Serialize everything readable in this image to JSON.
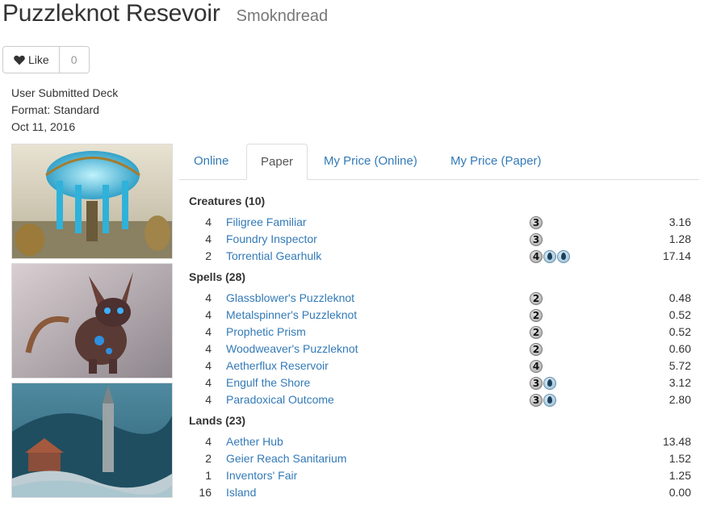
{
  "header": {
    "title": "Puzzleknot Resevoir",
    "author": "Smokndread"
  },
  "like": {
    "label": "Like",
    "count": "0"
  },
  "meta": {
    "line1": "User Submitted Deck",
    "line2": "Format: Standard",
    "line3": "Oct 11, 2016"
  },
  "tabs": [
    {
      "label": "Online"
    },
    {
      "label": "Paper"
    },
    {
      "label": "My Price (Online)"
    },
    {
      "label": "My Price (Paper)"
    }
  ],
  "active_tab": "Paper",
  "sections": [
    {
      "title": "Creatures (10)",
      "cards": [
        {
          "qty": "4",
          "name": "Filigree Familiar",
          "mana": [
            "3"
          ],
          "price": "3.16"
        },
        {
          "qty": "4",
          "name": "Foundry Inspector",
          "mana": [
            "3"
          ],
          "price": "1.28"
        },
        {
          "qty": "2",
          "name": "Torrential Gearhulk",
          "mana": [
            "4",
            "U",
            "U"
          ],
          "price": "17.14"
        }
      ]
    },
    {
      "title": "Spells (28)",
      "cards": [
        {
          "qty": "4",
          "name": "Glassblower's Puzzleknot",
          "mana": [
            "2"
          ],
          "price": "0.48"
        },
        {
          "qty": "4",
          "name": "Metalspinner's Puzzleknot",
          "mana": [
            "2"
          ],
          "price": "0.52"
        },
        {
          "qty": "4",
          "name": "Prophetic Prism",
          "mana": [
            "2"
          ],
          "price": "0.52"
        },
        {
          "qty": "4",
          "name": "Woodweaver's Puzzleknot",
          "mana": [
            "2"
          ],
          "price": "0.60"
        },
        {
          "qty": "4",
          "name": "Aetherflux Reservoir",
          "mana": [
            "4"
          ],
          "price": "5.72"
        },
        {
          "qty": "4",
          "name": "Engulf the Shore",
          "mana": [
            "3",
            "U"
          ],
          "price": "3.12"
        },
        {
          "qty": "4",
          "name": "Paradoxical Outcome",
          "mana": [
            "3",
            "U"
          ],
          "price": "2.80"
        }
      ]
    },
    {
      "title": "Lands (23)",
      "cards": [
        {
          "qty": "4",
          "name": "Aether Hub",
          "mana": [],
          "price": "13.48"
        },
        {
          "qty": "2",
          "name": "Geier Reach Sanitarium",
          "mana": [],
          "price": "1.52"
        },
        {
          "qty": "1",
          "name": "Inventors' Fair",
          "mana": [],
          "price": "1.25"
        },
        {
          "qty": "16",
          "name": "Island",
          "mana": [],
          "price": "0.00"
        }
      ]
    }
  ],
  "colors": {
    "link": "#337ab7",
    "text": "#333333",
    "muted": "#777777",
    "border": "#dddddd"
  }
}
